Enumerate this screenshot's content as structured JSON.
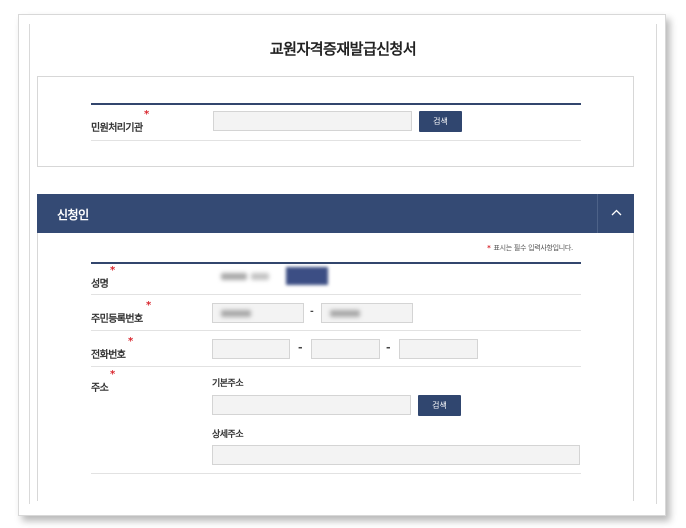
{
  "page": {
    "title": "교원자격증재발급신청서"
  },
  "org": {
    "label": "민원처리기관",
    "required_mark": "*",
    "input_value": "",
    "search_button": "검색"
  },
  "applicant": {
    "section_title": "신청인",
    "toggle_icon": "chevron-up-icon",
    "required_note_mark": "*",
    "required_note": "표시는 필수 입력사항입니다.",
    "fields": {
      "name": {
        "label": "성명",
        "required_mark": "*"
      },
      "rrn": {
        "label": "주민등록번호",
        "required_mark": "*",
        "separator": "-"
      },
      "phone": {
        "label": "전화번호",
        "required_mark": "*",
        "separator": "-",
        "part1": "",
        "part2": "",
        "part3": ""
      },
      "address": {
        "label": "주소",
        "required_mark": "*",
        "basic_label": "기본주소",
        "basic_value": "",
        "search_button": "검색",
        "detail_label": "상세주소",
        "detail_value": ""
      }
    }
  },
  "colors": {
    "navy": "#344a74",
    "button": "#30466f",
    "required": "#d9262e"
  }
}
